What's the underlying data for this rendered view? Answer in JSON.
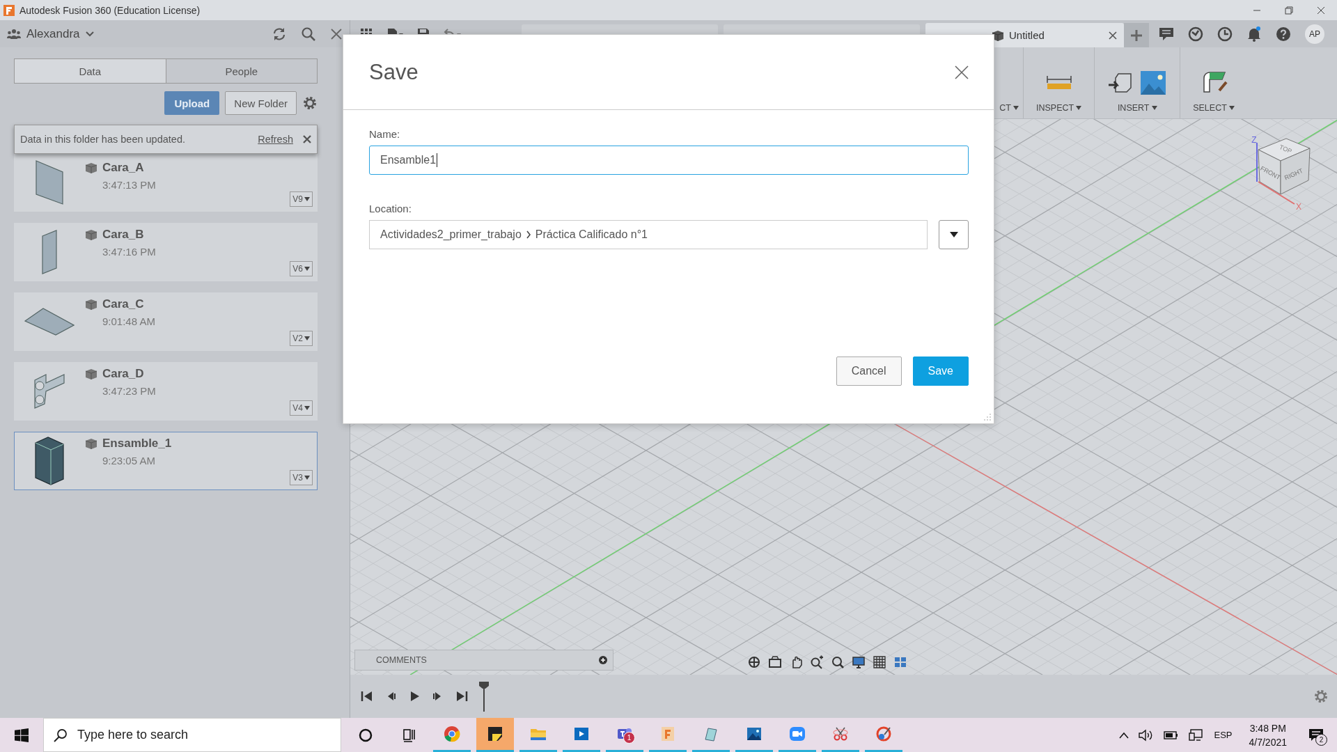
{
  "window": {
    "title": "Autodesk Fusion 360 (Education License)"
  },
  "data_panel": {
    "user": "Alexandra",
    "tabs": [
      {
        "label": "Data",
        "selected": true
      },
      {
        "label": "People",
        "selected": false
      }
    ],
    "upload": "Upload",
    "new_folder": "New Folder",
    "notice": {
      "text": "Data in this folder has been updated.",
      "link": "Refresh"
    },
    "files": [
      {
        "name": "Cara_A",
        "time": "3:47:13 PM",
        "version": "V9",
        "kind": "panel",
        "selected": false
      },
      {
        "name": "Cara_B",
        "time": "3:47:16 PM",
        "version": "V6",
        "kind": "narrow-panel",
        "selected": false
      },
      {
        "name": "Cara_C",
        "time": "9:01:48 AM",
        "version": "V2",
        "kind": "flat-panel",
        "selected": false
      },
      {
        "name": "Cara_D",
        "time": "3:47:23 PM",
        "version": "V4",
        "kind": "bracket",
        "selected": false
      },
      {
        "name": "Ensamble_1",
        "time": "9:23:05 AM",
        "version": "V3",
        "kind": "assembly",
        "selected": true
      }
    ]
  },
  "document_tabs": [
    {
      "label": "Untitled",
      "selected": true
    }
  ],
  "profile": {
    "initials": "AP"
  },
  "toolbar": [
    {
      "label": "CT",
      "kind": "hidden"
    },
    {
      "label": "INSPECT",
      "kind": "measure"
    },
    {
      "label": "INSERT",
      "kind": "insert"
    },
    {
      "label": "SELECT",
      "kind": "select"
    }
  ],
  "viewcube": {
    "top": "TOP",
    "front": "FRONT",
    "right": "RIGHT",
    "axes": [
      "Z",
      "X"
    ]
  },
  "comments": {
    "label": "COMMENTS"
  },
  "dialog": {
    "title": "Save",
    "name_label": "Name:",
    "name_value": "Ensamble1",
    "location_label": "Location:",
    "location_path": [
      "Actividades2_primer_trabajo",
      "Práctica Calificado n°1"
    ],
    "buttons": [
      {
        "label": "Cancel",
        "kind": "secondary"
      },
      {
        "label": "Save",
        "kind": "primary"
      }
    ]
  },
  "taskbar": {
    "search_placeholder": "Type here to search",
    "apps": [
      {
        "kind": "cortana",
        "open": false,
        "selected": false
      },
      {
        "kind": "task-view",
        "open": false,
        "selected": false
      },
      {
        "kind": "browser",
        "open": true,
        "selected": false
      },
      {
        "kind": "sticky",
        "open": true,
        "selected": true
      },
      {
        "kind": "folder",
        "open": true,
        "selected": false
      },
      {
        "kind": "media",
        "open": true,
        "selected": false
      },
      {
        "kind": "teams",
        "open": true,
        "selected": false,
        "badge": "1"
      },
      {
        "kind": "fusion",
        "open": true,
        "selected": false
      },
      {
        "kind": "paper",
        "open": true,
        "selected": false
      },
      {
        "kind": "photos",
        "open": true,
        "selected": false
      },
      {
        "kind": "video-call",
        "open": true,
        "selected": false
      },
      {
        "kind": "snip",
        "open": true,
        "selected": false
      },
      {
        "kind": "paint",
        "open": true,
        "selected": false
      }
    ],
    "language": "ESP",
    "time": "3:48 PM",
    "date": "4/7/2021",
    "notifications": "2"
  }
}
